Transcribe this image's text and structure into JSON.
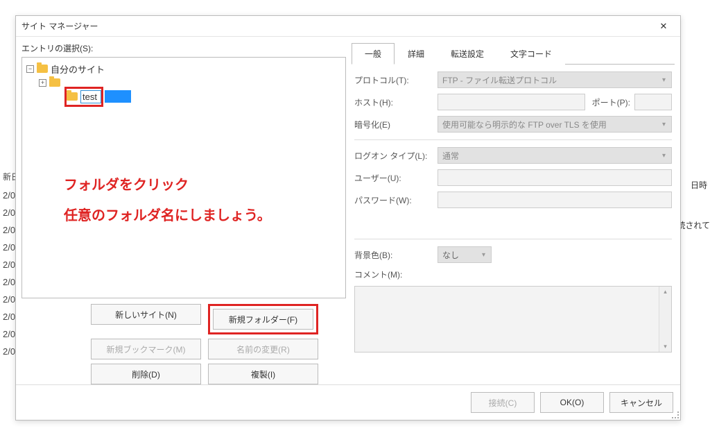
{
  "dialog_title": "サイト マネージャー",
  "left_label": "エントリの選択(S):",
  "tree": {
    "root": "自分のサイト",
    "child_edit": "test"
  },
  "annotation_line1": "フォルダをクリック",
  "annotation_line2": "任意のフォルダ名にしましょう。",
  "buttons": {
    "new_site": "新しいサイト(N)",
    "new_folder": "新規フォルダー(F)",
    "new_bookmark": "新規ブックマーク(M)",
    "rename": "名前の変更(R)",
    "delete": "削除(D)",
    "duplicate": "複製(I)"
  },
  "tabs": {
    "general": "一般",
    "detailed": "詳細",
    "transfer": "転送設定",
    "charset": "文字コード"
  },
  "form": {
    "protocol_label": "プロトコル(T):",
    "protocol_value": "FTP - ファイル転送プロトコル",
    "host_label": "ホスト(H):",
    "port_label": "ポート(P):",
    "encryption_label": "暗号化(E)",
    "encryption_value": "使用可能なら明示的な FTP over TLS を使用",
    "logon_label": "ログオン タイプ(L):",
    "logon_value": "通常",
    "user_label": "ユーザー(U):",
    "password_label": "パスワード(W):",
    "bgcolor_label": "背景色(B):",
    "bgcolor_value": "なし",
    "comment_label": "コメント(M):"
  },
  "footer": {
    "connect": "接続(C)",
    "ok": "OK(O)",
    "cancel": "キャンセル"
  },
  "bg": {
    "left_header": "新日",
    "right_header": "日時",
    "right_text": "続されて",
    "rows": [
      "2/0",
      "2/0",
      "2/0",
      "2/0",
      "2/0",
      "2/0",
      "2/0",
      "2/0",
      "2/0",
      "2/0"
    ]
  }
}
